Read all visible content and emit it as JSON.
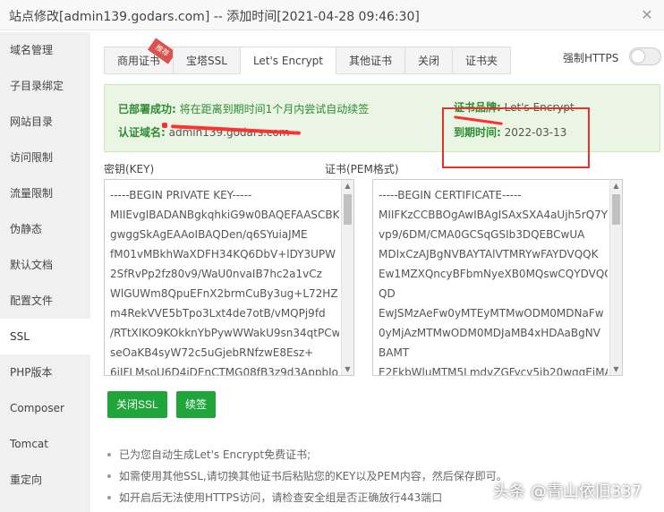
{
  "window": {
    "title": "站点修改[admin139.godars.com] -- 添加时间[2021-04-28 09:46:30]",
    "close": "✕"
  },
  "sidebar": {
    "items": [
      {
        "label": "域名管理"
      },
      {
        "label": "子目录绑定"
      },
      {
        "label": "网站目录"
      },
      {
        "label": "访问限制"
      },
      {
        "label": "流量限制"
      },
      {
        "label": "伪静态"
      },
      {
        "label": "默认文档"
      },
      {
        "label": "配置文件"
      },
      {
        "label": "SSL"
      },
      {
        "label": "PHP版本"
      },
      {
        "label": "Composer"
      },
      {
        "label": "Tomcat"
      },
      {
        "label": "重定向"
      }
    ]
  },
  "tabs": [
    {
      "label": "商用证书",
      "badge": "推荐"
    },
    {
      "label": "宝塔SSL"
    },
    {
      "label": "Let's Encrypt"
    },
    {
      "label": "其他证书"
    },
    {
      "label": "关闭"
    },
    {
      "label": "证书夹"
    }
  ],
  "force_https": {
    "label": "强制HTTPS",
    "enabled": false
  },
  "info": {
    "status_key": "已部署成功:",
    "status_val": "将在距离到期时间1个月内尝试自动续签",
    "domain_key": "认证域名:",
    "domain_val": "admin139.godars.com",
    "brand_key": "证书品牌:",
    "brand_val": "Let's Encrypt",
    "expire_key": "到期时间:",
    "expire_val": "2022-03-13"
  },
  "key_panel": {
    "label": "密钥(KEY)",
    "lines": [
      "-----BEGIN PRIVATE KEY-----",
      "MIIEvgIBADANBgkqhkiG9w0BAQEFAASCBK",
      "gwggSkAgEAAoIBAQDen/q6SYuiaJME",
      "fM01vMBkhWaXDFH34KQ6DbV+lDY3UPW",
      "2SfRvPp2fz80v9/WaU0nvaIB7hc2a1vCz",
      "WlGUWm8QpuEFnX2brmCuBy3ug+L72HZ",
      "m4RekVVE5bTpo3Lxt4de7otB/vMQPj9fd",
      "/RTtXIKO9KOkknYbPywWWakU9sn34qtPCw",
      "seOaKB4syW72c5uGjebRNfzwE8Esz+",
      "6jIFLMsoU6D4iDEnCTMG08fB3z9d3AppbIo"
    ]
  },
  "cert_panel": {
    "label": "证书(PEM格式)",
    "lines": [
      "-----BEGIN CERTIFICATE-----",
      "MIIFKzCCBBOgAwIBAgISAxSXA4aUjh5rQ7Y",
      "vp9/6DM/CMA0GCSqGSIb3DQEBCwUA",
      "MDIxCzAJBgNVBAYTAlVTMRYwFAYDVQQK",
      "Ew1MZXQncyBFbmNyeXB0MQswCQYDVQQ",
      "QD",
      "EwJSMzAeFw0yMTEyMTMwODM0MDNaFw",
      "0yMjAzMTMwODM0MDJaMB4xHDAaBgNV",
      "BAMT",
      "E2FkbWluMTM5LmdvZGFycy5jb20wggEiMA"
    ]
  },
  "buttons": {
    "close_ssl": "关闭SSL",
    "renew": "续签"
  },
  "tips": [
    "已为您自动生成Let's Encrypt免费证书;",
    "如需使用其他SSL,请切换其他证书后粘贴您的KEY以及PEM内容，然后保存即可。",
    "如开启后无法使用HTTPS访问，请检查安全组是否正确放行443端口"
  ],
  "watermark": "头条 @青山依旧337",
  "colors": {
    "accent_green": "#20a53a",
    "info_text": "#2e8b34",
    "info_bg": "#eaf6e3",
    "annotation_red": "#e5322d"
  }
}
